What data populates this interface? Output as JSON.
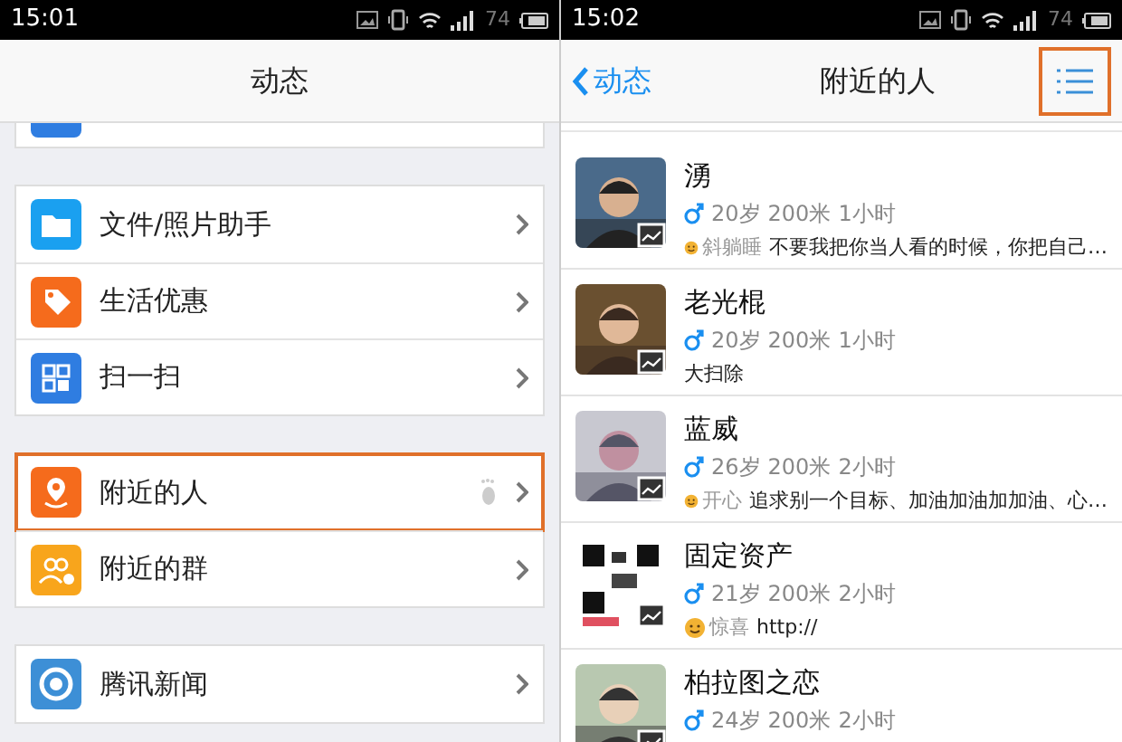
{
  "left": {
    "status_bar": {
      "time": "15:01",
      "battery": "74"
    },
    "header": {
      "title": "动态"
    },
    "groups": [
      [
        {
          "kind": "folder",
          "label": "文件/照片助手",
          "highlighted": false,
          "footprint": false
        },
        {
          "kind": "tag",
          "label": "生活优惠",
          "highlighted": false,
          "footprint": false
        },
        {
          "kind": "scan",
          "label": "扫一扫",
          "highlighted": false,
          "footprint": false
        }
      ],
      [
        {
          "kind": "location",
          "label": "附近的人",
          "highlighted": true,
          "footprint": true
        },
        {
          "kind": "group",
          "label": "附近的群",
          "highlighted": false,
          "footprint": false
        }
      ],
      [
        {
          "kind": "news",
          "label": "腾讯新闻",
          "highlighted": false,
          "footprint": false
        }
      ]
    ]
  },
  "right": {
    "status_bar": {
      "time": "15:02",
      "battery": "74"
    },
    "header": {
      "back": "动态",
      "title": "附近的人",
      "menu_highlighted": true
    },
    "people": [
      {
        "name": "湧",
        "age": "20岁",
        "distance": "200米",
        "time": "1小时",
        "mood": "斜躺睡",
        "status": "不要我把你当人看的时候，你把自己…"
      },
      {
        "name": "老光棍",
        "age": "20岁",
        "distance": "200米",
        "time": "1小时",
        "status": "大扫除"
      },
      {
        "name": "蓝威",
        "age": "26岁",
        "distance": "200米",
        "time": "2小时",
        "mood": "开心",
        "status": "追求别一个目标、加油加油加加油、心…"
      },
      {
        "name": "固定资产",
        "age": "21岁",
        "distance": "200米",
        "time": "2小时",
        "mood": "惊喜",
        "status": "http://"
      },
      {
        "name": "柏拉图之恋",
        "age": "24岁",
        "distance": "200米",
        "time": "2小时"
      }
    ]
  }
}
